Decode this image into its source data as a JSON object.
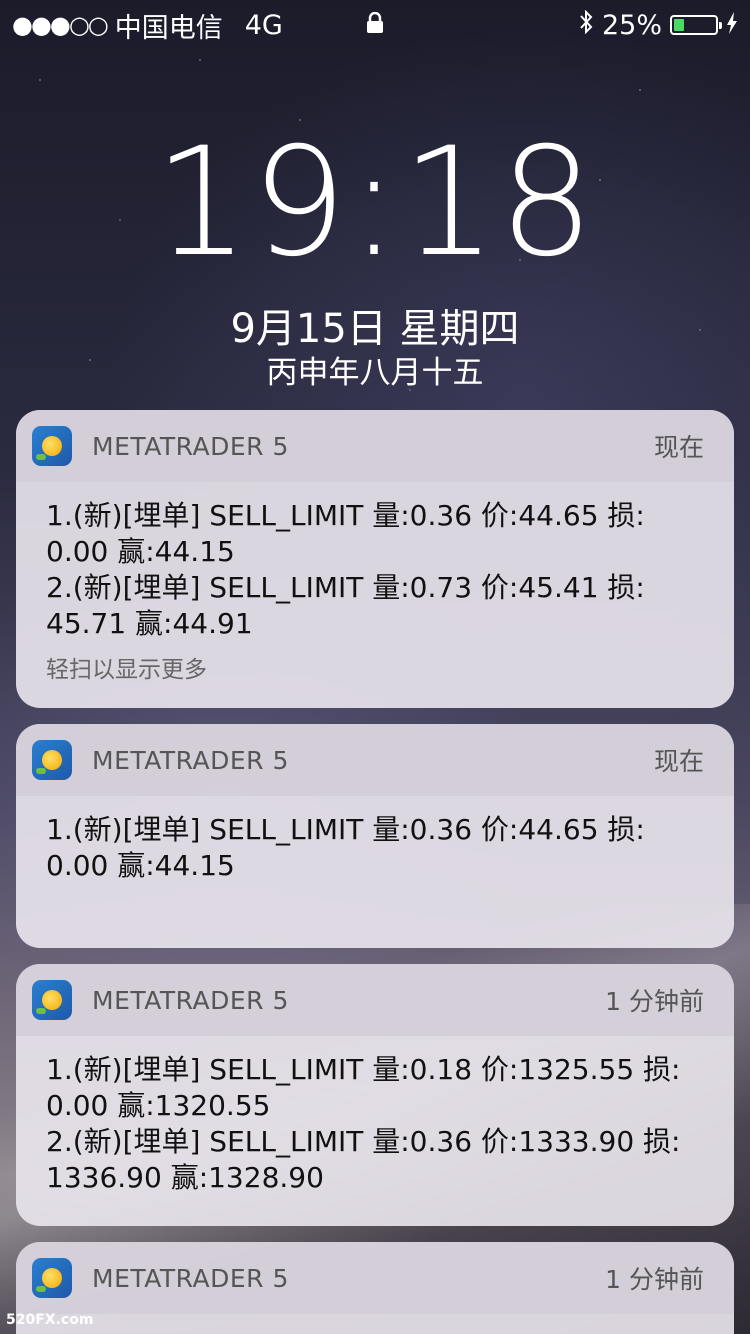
{
  "status_bar": {
    "signal": "●●●○○",
    "carrier": "中国电信",
    "network": "4G",
    "battery_percent": "25%",
    "battery_level": 0.25
  },
  "lock_screen": {
    "time": "19:18",
    "date": "9月15日 星期四",
    "lunar_date": "丙申年八月十五"
  },
  "notifications": [
    {
      "app": "METATRADER 5",
      "time": "现在",
      "lines": [
        "1.(新)[埋单] SELL_LIMIT 量:0.36 价:44.65 损:",
        "0.00 赢:44.15",
        "2.(新)[埋单] SELL_LIMIT 量:0.73 价:45.41 损:",
        "45.71 赢:44.91"
      ],
      "hint": "轻扫以显示更多"
    },
    {
      "app": "METATRADER 5",
      "time": "现在",
      "lines": [
        "1.(新)[埋单] SELL_LIMIT 量:0.36 价:44.65 损:",
        "0.00 赢:44.15"
      ]
    },
    {
      "app": "METATRADER 5",
      "time": "1 分钟前",
      "lines": [
        "1.(新)[埋单] SELL_LIMIT 量:0.18 价:1325.55 损:",
        "0.00 赢:1320.55",
        "2.(新)[埋单] SELL_LIMIT 量:0.36 价:1333.90 损:",
        "1336.90 赢:1328.90"
      ]
    },
    {
      "app": "METATRADER 5",
      "time": "1 分钟前"
    }
  ],
  "watermark": "520FX.com",
  "colors": {
    "battery_fill": "#4cd964",
    "card_bg": "#e8e4ec"
  }
}
